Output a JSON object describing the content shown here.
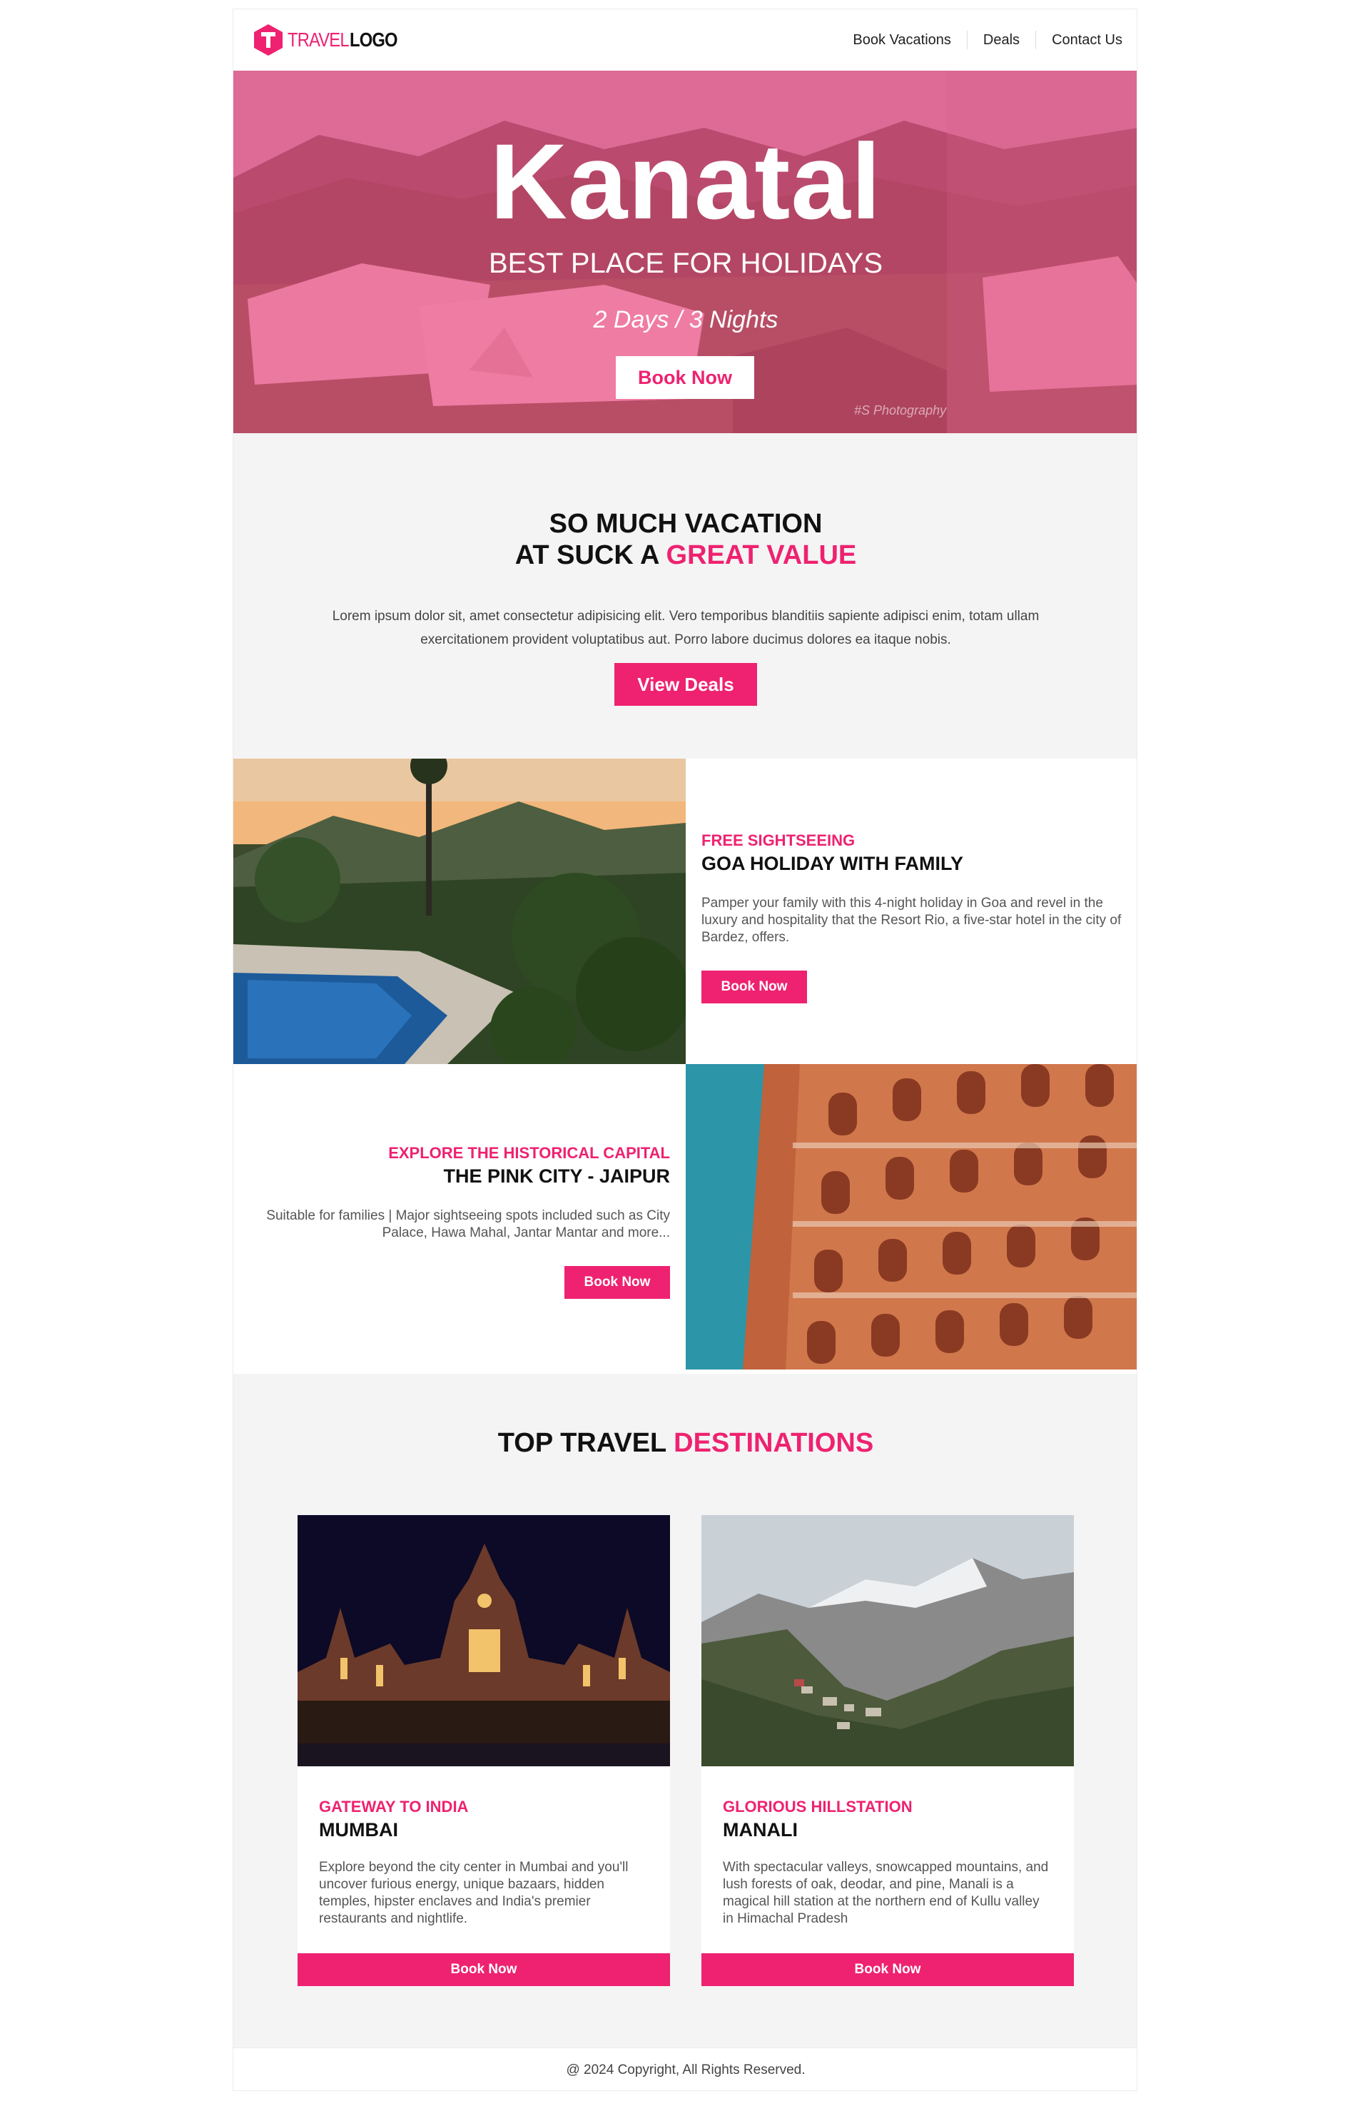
{
  "header": {
    "logo_word1": "TRAVEL",
    "logo_word2": "LOGO",
    "nav": [
      "Book Vacations",
      "Deals",
      "Contact Us"
    ]
  },
  "hero": {
    "title": "Kanatal",
    "subtitle": "BEST PLACE FOR HOLIDAYS",
    "duration": "2 Days / 3 Nights",
    "button": "Book Now",
    "watermark": "#S Photography"
  },
  "value": {
    "heading_line1": "SO MUCH VACATION",
    "heading_line2_plain": "AT SUCK A",
    "heading_line2_accent": "GREAT VALUE",
    "text": "Lorem ipsum dolor sit, amet consectetur adipisicing elit. Vero temporibus blanditiis sapiente adipisci enim, totam ullam exercitationem provident voluptatibus aut. Porro labore ducimus dolores ea itaque nobis.",
    "button": "View Deals"
  },
  "features": [
    {
      "kicker": "FREE SIGHTSEEING",
      "title": "GOA HOLIDAY WITH FAMILY",
      "desc": "Pamper your family with this 4-night holiday in Goa and revel in the luxury and hospitality that the Resort Rio, a five-star hotel in the city of Bardez, offers.",
      "button": "Book Now"
    },
    {
      "kicker": "EXPLORE THE HISTORICAL CAPITAL",
      "title": "THE PINK CITY - JAIPUR",
      "desc": "Suitable for families | Major sightseeing spots included such as City Palace, Hawa Mahal, Jantar Mantar and more...",
      "button": "Book Now"
    }
  ],
  "destinations": {
    "title_plain": "TOP TRAVEL",
    "title_accent": "DESTINATIONS",
    "cards": [
      {
        "kicker": "GATEWAY TO INDIA",
        "title": "MUMBAI",
        "desc": "Explore beyond the city center in Mumbai and you'll uncover furious energy, unique bazaars, hidden temples, hipster enclaves and India's premier restaurants and nightlife.",
        "button": "Book Now"
      },
      {
        "kicker": "GLORIOUS HILLSTATION",
        "title": "MANALI",
        "desc": "With spectacular valleys, snowcapped mountains, and lush forests of oak, deodar, and pine, Manali is a magical hill station at the northern end of Kullu valley in Himachal Pradesh",
        "button": "Book Now"
      }
    ]
  },
  "footer": {
    "text": "@ 2024 Copyright, All Rights Reserved."
  },
  "colors": {
    "accent": "#ee2270",
    "section_bg": "#f4f4f4"
  }
}
